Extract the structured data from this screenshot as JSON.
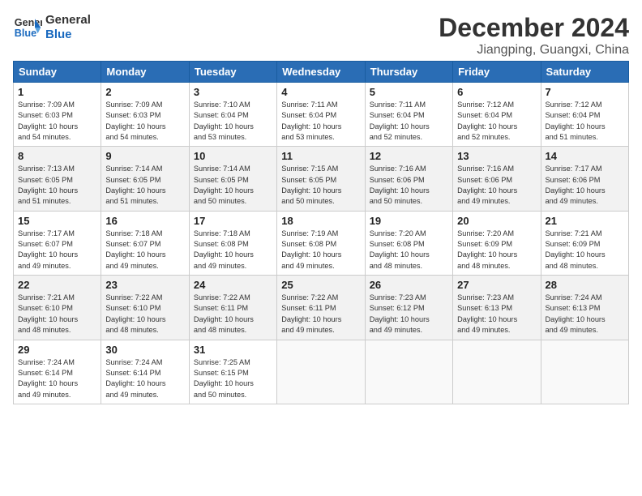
{
  "header": {
    "logo_line1": "General",
    "logo_line2": "Blue",
    "month": "December 2024",
    "location": "Jiangping, Guangxi, China"
  },
  "weekdays": [
    "Sunday",
    "Monday",
    "Tuesday",
    "Wednesday",
    "Thursday",
    "Friday",
    "Saturday"
  ],
  "weeks": [
    [
      {
        "day": "1",
        "info": "Sunrise: 7:09 AM\nSunset: 6:03 PM\nDaylight: 10 hours\nand 54 minutes."
      },
      {
        "day": "2",
        "info": "Sunrise: 7:09 AM\nSunset: 6:03 PM\nDaylight: 10 hours\nand 54 minutes."
      },
      {
        "day": "3",
        "info": "Sunrise: 7:10 AM\nSunset: 6:04 PM\nDaylight: 10 hours\nand 53 minutes."
      },
      {
        "day": "4",
        "info": "Sunrise: 7:11 AM\nSunset: 6:04 PM\nDaylight: 10 hours\nand 53 minutes."
      },
      {
        "day": "5",
        "info": "Sunrise: 7:11 AM\nSunset: 6:04 PM\nDaylight: 10 hours\nand 52 minutes."
      },
      {
        "day": "6",
        "info": "Sunrise: 7:12 AM\nSunset: 6:04 PM\nDaylight: 10 hours\nand 52 minutes."
      },
      {
        "day": "7",
        "info": "Sunrise: 7:12 AM\nSunset: 6:04 PM\nDaylight: 10 hours\nand 51 minutes."
      }
    ],
    [
      {
        "day": "8",
        "info": "Sunrise: 7:13 AM\nSunset: 6:05 PM\nDaylight: 10 hours\nand 51 minutes."
      },
      {
        "day": "9",
        "info": "Sunrise: 7:14 AM\nSunset: 6:05 PM\nDaylight: 10 hours\nand 51 minutes."
      },
      {
        "day": "10",
        "info": "Sunrise: 7:14 AM\nSunset: 6:05 PM\nDaylight: 10 hours\nand 50 minutes."
      },
      {
        "day": "11",
        "info": "Sunrise: 7:15 AM\nSunset: 6:05 PM\nDaylight: 10 hours\nand 50 minutes."
      },
      {
        "day": "12",
        "info": "Sunrise: 7:16 AM\nSunset: 6:06 PM\nDaylight: 10 hours\nand 50 minutes."
      },
      {
        "day": "13",
        "info": "Sunrise: 7:16 AM\nSunset: 6:06 PM\nDaylight: 10 hours\nand 49 minutes."
      },
      {
        "day": "14",
        "info": "Sunrise: 7:17 AM\nSunset: 6:06 PM\nDaylight: 10 hours\nand 49 minutes."
      }
    ],
    [
      {
        "day": "15",
        "info": "Sunrise: 7:17 AM\nSunset: 6:07 PM\nDaylight: 10 hours\nand 49 minutes."
      },
      {
        "day": "16",
        "info": "Sunrise: 7:18 AM\nSunset: 6:07 PM\nDaylight: 10 hours\nand 49 minutes."
      },
      {
        "day": "17",
        "info": "Sunrise: 7:18 AM\nSunset: 6:08 PM\nDaylight: 10 hours\nand 49 minutes."
      },
      {
        "day": "18",
        "info": "Sunrise: 7:19 AM\nSunset: 6:08 PM\nDaylight: 10 hours\nand 49 minutes."
      },
      {
        "day": "19",
        "info": "Sunrise: 7:20 AM\nSunset: 6:08 PM\nDaylight: 10 hours\nand 48 minutes."
      },
      {
        "day": "20",
        "info": "Sunrise: 7:20 AM\nSunset: 6:09 PM\nDaylight: 10 hours\nand 48 minutes."
      },
      {
        "day": "21",
        "info": "Sunrise: 7:21 AM\nSunset: 6:09 PM\nDaylight: 10 hours\nand 48 minutes."
      }
    ],
    [
      {
        "day": "22",
        "info": "Sunrise: 7:21 AM\nSunset: 6:10 PM\nDaylight: 10 hours\nand 48 minutes."
      },
      {
        "day": "23",
        "info": "Sunrise: 7:22 AM\nSunset: 6:10 PM\nDaylight: 10 hours\nand 48 minutes."
      },
      {
        "day": "24",
        "info": "Sunrise: 7:22 AM\nSunset: 6:11 PM\nDaylight: 10 hours\nand 48 minutes."
      },
      {
        "day": "25",
        "info": "Sunrise: 7:22 AM\nSunset: 6:11 PM\nDaylight: 10 hours\nand 49 minutes."
      },
      {
        "day": "26",
        "info": "Sunrise: 7:23 AM\nSunset: 6:12 PM\nDaylight: 10 hours\nand 49 minutes."
      },
      {
        "day": "27",
        "info": "Sunrise: 7:23 AM\nSunset: 6:13 PM\nDaylight: 10 hours\nand 49 minutes."
      },
      {
        "day": "28",
        "info": "Sunrise: 7:24 AM\nSunset: 6:13 PM\nDaylight: 10 hours\nand 49 minutes."
      }
    ],
    [
      {
        "day": "29",
        "info": "Sunrise: 7:24 AM\nSunset: 6:14 PM\nDaylight: 10 hours\nand 49 minutes."
      },
      {
        "day": "30",
        "info": "Sunrise: 7:24 AM\nSunset: 6:14 PM\nDaylight: 10 hours\nand 49 minutes."
      },
      {
        "day": "31",
        "info": "Sunrise: 7:25 AM\nSunset: 6:15 PM\nDaylight: 10 hours\nand 50 minutes."
      },
      {
        "day": "",
        "info": ""
      },
      {
        "day": "",
        "info": ""
      },
      {
        "day": "",
        "info": ""
      },
      {
        "day": "",
        "info": ""
      }
    ]
  ]
}
